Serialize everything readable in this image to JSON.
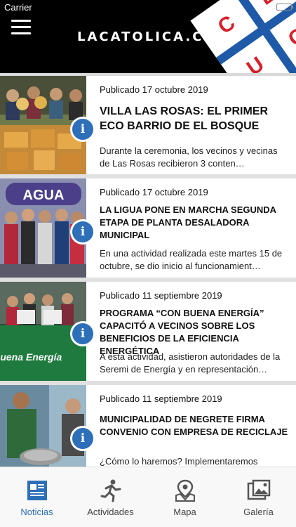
{
  "status": {
    "carrier": "Carrier"
  },
  "header": {
    "brand": "LACATOLICA.CL",
    "badge_letters": [
      "C",
      "D",
      "U",
      "C"
    ]
  },
  "posts": [
    {
      "date": "Publicado 17 octubre 2019",
      "title": "VILLA LAS ROSAS: EL PRIMER ECO BARRIO DE EL BOSQUE",
      "excerpt": "Durante la ceremonia, los vecinos y vecinas de Las Rosas recibieron 3 conten…"
    },
    {
      "date": "Publicado 17 octubre 2019",
      "title": "LA LIGUA PONE EN MARCHA SEGUNDA ETAPA DE PLANTA DESALADORA MUNICIPAL",
      "excerpt": "En una actividad realizada este martes 15 de octubre, se dio inicio al funcionamient…",
      "image_text": "AGUA"
    },
    {
      "date": "Publicado 11 septiembre 2019",
      "title": "PROGRAMA “CON BUENA ENERGÍA” CAPACITÓ A VECINOS SOBRE LOS BENEFICIOS DE LA EFICIENCIA ENERGÉTICA",
      "excerpt": "A esta actividad, asistieron autoridades de la Seremi de Energía y en representación…",
      "image_text": "buena Energía"
    },
    {
      "date": "Publicado 11 septiembre 2019",
      "title": "MUNICIPALIDAD DE NEGRETE FIRMA CONVENIO CON EMPRESA DE RECICLAJE",
      "excerpt": "¿Cómo lo haremos? Implementaremos"
    }
  ],
  "info_glyph": "i",
  "tabs": [
    {
      "label": "Noticias",
      "icon": "newspaper-icon",
      "active": true
    },
    {
      "label": "Actividades",
      "icon": "runner-icon",
      "active": false
    },
    {
      "label": "Mapa",
      "icon": "map-pin-icon",
      "active": false
    },
    {
      "label": "Galería",
      "icon": "gallery-icon",
      "active": false
    }
  ],
  "colors": {
    "accent": "#2d6fb8",
    "badge_red": "#d6202a",
    "badge_blue": "#1e5aa8",
    "header_bg": "#000000"
  }
}
